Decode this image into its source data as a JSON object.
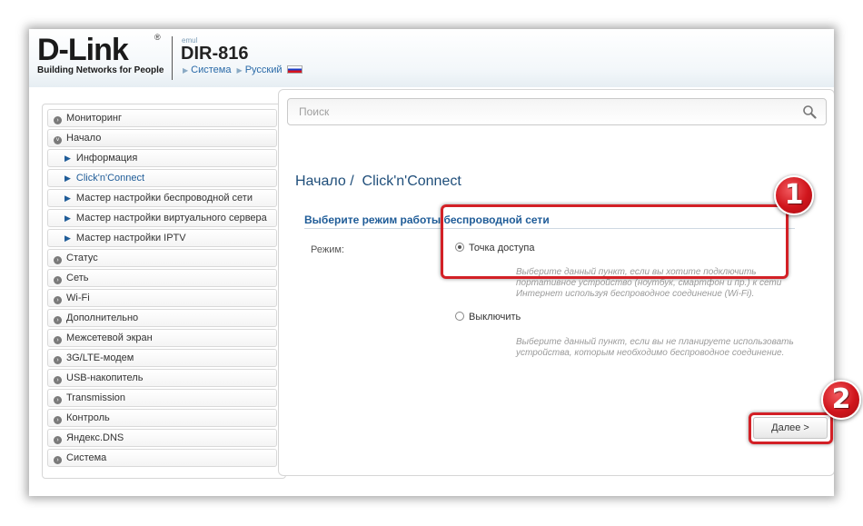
{
  "header": {
    "logo": "D-Link",
    "logo_reg": "®",
    "tagline": "Building Networks for People",
    "emul": "emul",
    "model": "DIR-816",
    "crumb_system": "Система",
    "crumb_language": "Русский"
  },
  "sidebar": {
    "items": [
      {
        "label": "Мониторинг"
      },
      {
        "label": "Начало"
      },
      {
        "label": "Информация"
      },
      {
        "label": "Click'n'Connect"
      },
      {
        "label": "Мастер настройки беспроводной сети"
      },
      {
        "label": "Мастер настройки виртуального сервера"
      },
      {
        "label": "Мастер настройки IPTV"
      },
      {
        "label": "Статус"
      },
      {
        "label": "Сеть"
      },
      {
        "label": "Wi-Fi"
      },
      {
        "label": "Дополнительно"
      },
      {
        "label": "Межсетевой экран"
      },
      {
        "label": "3G/LTE-модем"
      },
      {
        "label": "USB-накопитель"
      },
      {
        "label": "Transmission"
      },
      {
        "label": "Контроль"
      },
      {
        "label": "Яндекс.DNS"
      },
      {
        "label": "Система"
      }
    ]
  },
  "search": {
    "placeholder": "Поиск"
  },
  "main": {
    "breadcrumb_parent": "Начало /",
    "breadcrumb_current": "Click'n'Connect",
    "section_title": "Выберите режим работы беспроводной сети",
    "mode_label": "Режим:",
    "options": [
      {
        "label": "Точка доступа",
        "selected": true,
        "desc1": "Выберите данный пункт, если вы хотите подключить",
        "desc2": "портативное устройство (ноутбук, смартфон и пр.) к сети",
        "desc3": "Интернет используя беспроводное соединение (Wi-Fi)."
      },
      {
        "label": "Выключить",
        "selected": false,
        "desc1": "Выберите данный пункт, если вы не планируете использовать",
        "desc2": "устройства, которым необходимо беспроводное соединение."
      }
    ],
    "next_label": "Далее >"
  },
  "annotations": {
    "marker1": "1",
    "marker2": "2",
    "color": "#d32026"
  }
}
